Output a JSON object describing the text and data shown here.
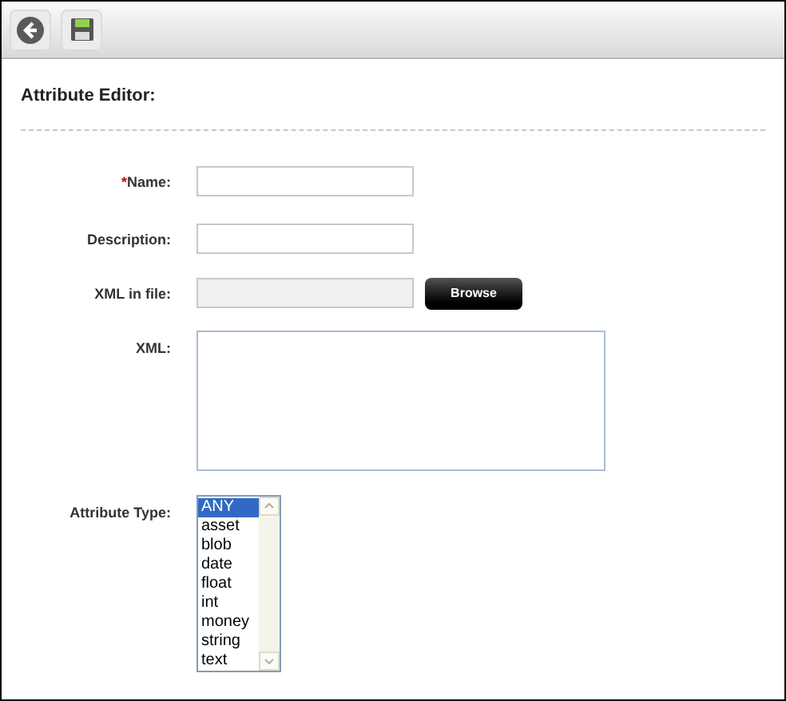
{
  "toolbar": {
    "buttons": [
      {
        "kind": "back"
      },
      {
        "kind": "save"
      }
    ]
  },
  "heading": "Attribute Editor:",
  "fields": [
    {
      "kind": "text",
      "label": "Name:",
      "required_mark": "*"
    },
    {
      "kind": "text",
      "label": "Description:"
    },
    {
      "kind": "file",
      "label": "XML in file:",
      "button": "Browse",
      "disabled": true
    },
    {
      "kind": "textarea",
      "label": "XML:"
    },
    {
      "kind": "listbox",
      "label": "Attribute Type:",
      "options": [
        {
          "label": "ANY",
          "selected": true
        },
        {
          "label": "asset",
          "selected": false
        },
        {
          "label": "blob",
          "selected": false
        },
        {
          "label": "date",
          "selected": false
        },
        {
          "label": "float",
          "selected": false
        },
        {
          "label": "int",
          "selected": false
        },
        {
          "label": "money",
          "selected": false
        },
        {
          "label": "string",
          "selected": false
        },
        {
          "label": "text",
          "selected": false
        }
      ]
    }
  ]
}
